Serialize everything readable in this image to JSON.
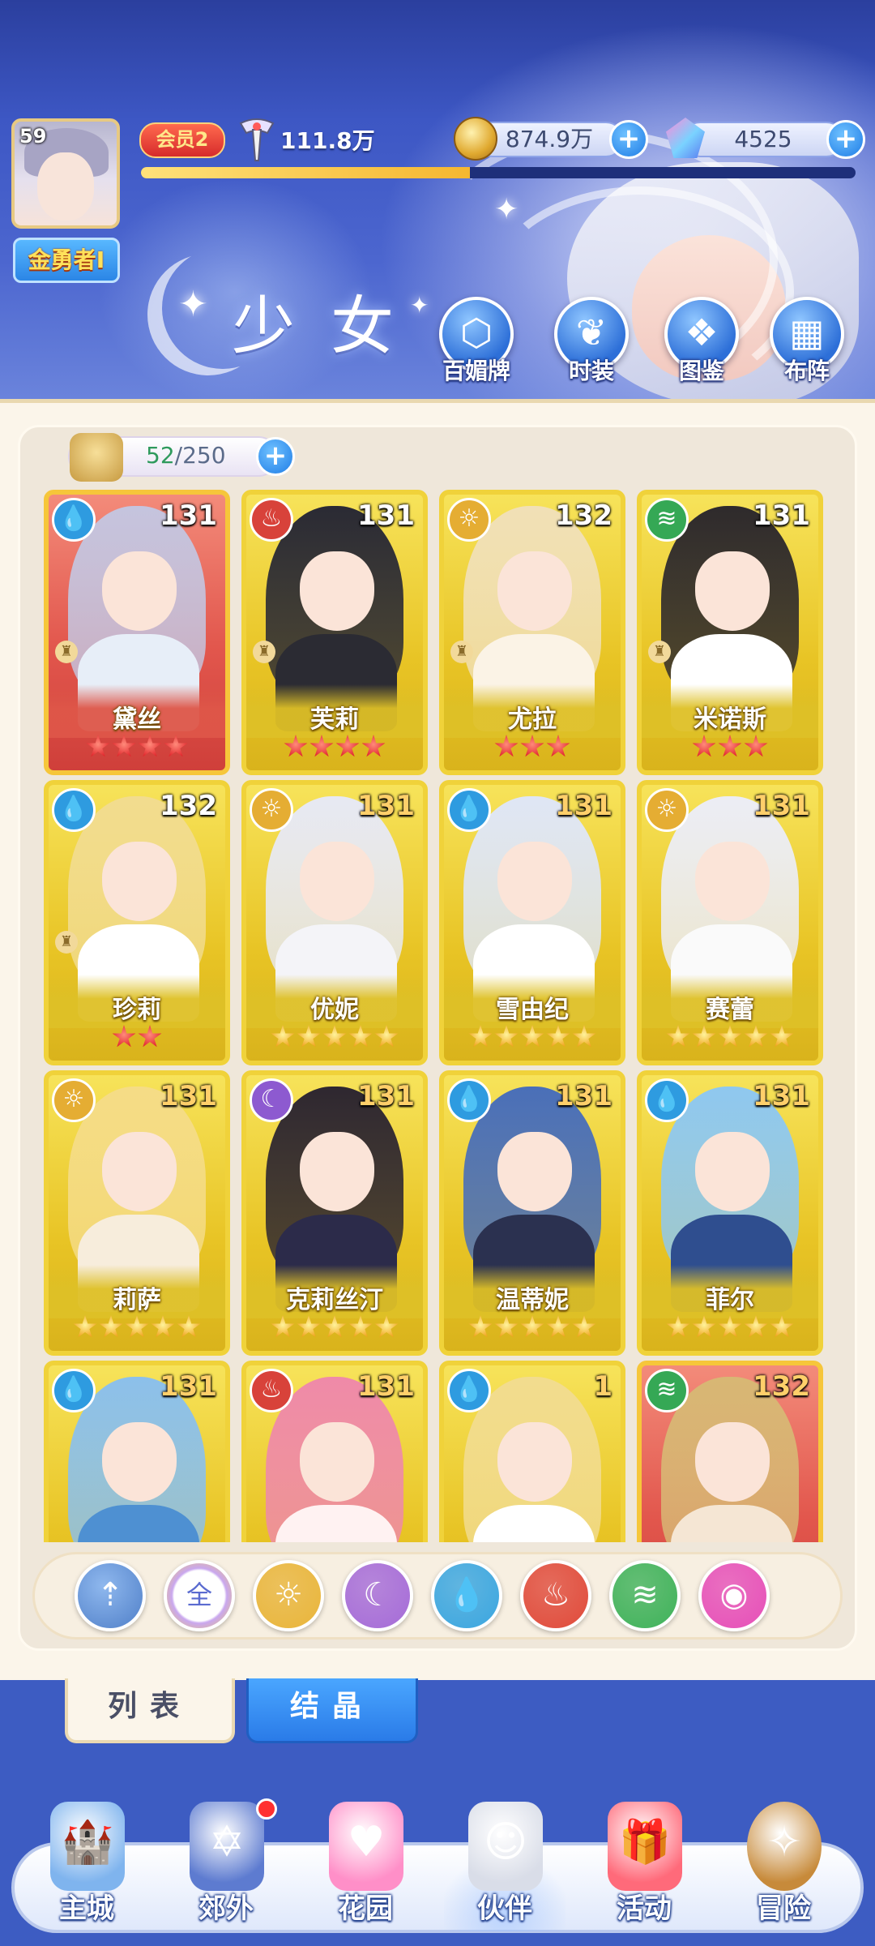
{
  "player": {
    "level": "59",
    "name": "金勇者I",
    "vip": "会员2",
    "power": "111.8万",
    "exp_fraction": 0.46
  },
  "resources": {
    "gold": "874.9万",
    "gems": "4525"
  },
  "title": "少女",
  "top_menu": [
    {
      "label": "百媚牌",
      "icon": "card-deck-icon"
    },
    {
      "label": "时装",
      "icon": "costume-icon"
    },
    {
      "label": "图鉴",
      "icon": "book-icon"
    },
    {
      "label": "布阵",
      "icon": "grid-formation-icon"
    }
  ],
  "capacity": {
    "current": "52",
    "sep": "/250"
  },
  "cards": [
    {
      "name": "黛丝",
      "level": "131",
      "element": "water",
      "stars": 4,
      "star_color": "red",
      "frame": "red",
      "rook": true
    },
    {
      "name": "芙莉",
      "level": "131",
      "element": "fire",
      "stars": 4,
      "star_color": "red",
      "frame": "gold",
      "rook": true
    },
    {
      "name": "尤拉",
      "level": "132",
      "element": "light",
      "stars": 3,
      "star_color": "red",
      "frame": "gold",
      "rook": true
    },
    {
      "name": "米诺斯",
      "level": "131",
      "element": "wind",
      "stars": 3,
      "star_color": "red",
      "frame": "gold",
      "rook": true
    },
    {
      "name": "珍莉",
      "level": "132",
      "element": "water",
      "stars": 2,
      "star_color": "red",
      "frame": "gold",
      "rook": true
    },
    {
      "name": "优妮",
      "level": "131",
      "element": "light",
      "stars": 5,
      "star_color": "gold",
      "frame": "gold",
      "rook": false
    },
    {
      "name": "雪由纪",
      "level": "131",
      "element": "water",
      "stars": 5,
      "star_color": "gold",
      "frame": "gold",
      "rook": false
    },
    {
      "name": "赛蕾",
      "level": "131",
      "element": "light",
      "stars": 5,
      "star_color": "gold",
      "frame": "gold",
      "rook": false
    },
    {
      "name": "莉萨",
      "level": "131",
      "element": "light",
      "stars": 5,
      "star_color": "gold",
      "frame": "gold",
      "rook": false
    },
    {
      "name": "克莉丝汀",
      "level": "131",
      "element": "dark",
      "stars": 5,
      "star_color": "gold",
      "frame": "gold",
      "rook": false
    },
    {
      "name": "温蒂妮",
      "level": "131",
      "element": "water",
      "stars": 5,
      "star_color": "gold",
      "frame": "gold",
      "rook": false
    },
    {
      "name": "菲尔",
      "level": "131",
      "element": "water",
      "stars": 5,
      "star_color": "gold",
      "frame": "gold",
      "rook": false
    },
    {
      "name": "",
      "level": "131",
      "element": "water",
      "stars": 0,
      "star_color": "gold",
      "frame": "gold",
      "rook": false
    },
    {
      "name": "",
      "level": "131",
      "element": "fire",
      "stars": 0,
      "star_color": "gold",
      "frame": "gold",
      "rook": false
    },
    {
      "name": "",
      "level": "1",
      "element": "water",
      "stars": 0,
      "star_color": "gold",
      "frame": "gold",
      "rook": false
    },
    {
      "name": "",
      "level": "132",
      "element": "wind",
      "stars": 0,
      "star_color": "gold",
      "frame": "red",
      "rook": false
    }
  ],
  "filters": [
    {
      "id": "sort",
      "label": "",
      "icon": "sort-arrows-icon",
      "color": "#4f8ad8"
    },
    {
      "id": "all",
      "label": "全",
      "icon": "all-icon",
      "color": "#ffffff"
    },
    {
      "id": "light",
      "label": "",
      "icon": "sun-icon",
      "color": "#e9b53a"
    },
    {
      "id": "dark",
      "label": "",
      "icon": "moon-icon",
      "color": "#a56bd8"
    },
    {
      "id": "water",
      "label": "",
      "icon": "water-drop-icon",
      "color": "#3aa6e0"
    },
    {
      "id": "fire",
      "label": "",
      "icon": "fire-icon",
      "color": "#e04a3a"
    },
    {
      "id": "wind",
      "label": "",
      "icon": "wind-icon",
      "color": "#3fb25a"
    },
    {
      "id": "special",
      "label": "",
      "icon": "orb-icon",
      "color": "#e64fb8"
    }
  ],
  "tabs": {
    "list": "列表",
    "crystal": "结晶"
  },
  "nav": [
    {
      "label": "主城",
      "icon": "castle-icon",
      "dot": false
    },
    {
      "label": "郊外",
      "icon": "magic-circle-icon",
      "dot": true
    },
    {
      "label": "花园",
      "icon": "heart-icon",
      "dot": false
    },
    {
      "label": "伙伴",
      "icon": "partner-portrait-icon",
      "dot": false
    },
    {
      "label": "活动",
      "icon": "gift-box-icon",
      "dot": false
    },
    {
      "label": "冒险",
      "icon": "compass-icon",
      "dot": false
    }
  ],
  "colors": {
    "water": "#2e9be0",
    "fire": "#d8423a",
    "light": "#e5ad33",
    "dark": "#8d5ad0",
    "wind": "#35a855"
  }
}
